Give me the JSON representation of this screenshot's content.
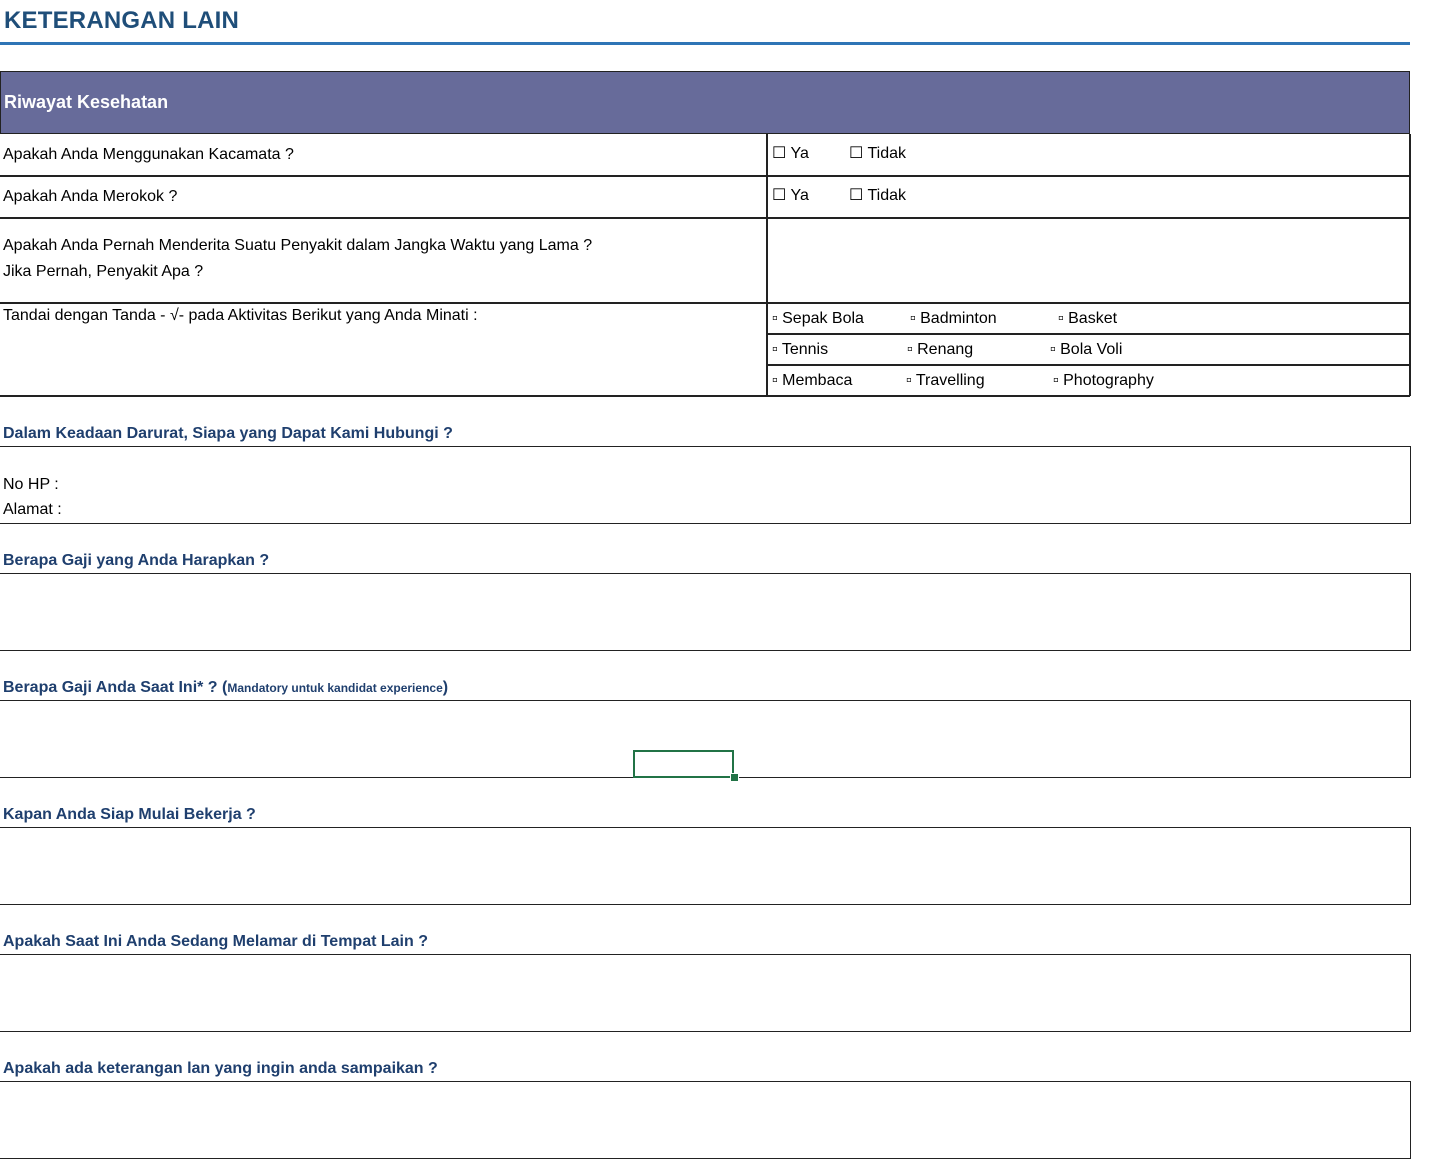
{
  "page_title": "KETERANGAN LAIN",
  "health": {
    "header": "Riwayat Kesehatan",
    "q_glasses": "Apakah Anda Menggunakan Kacamata ?",
    "q_smoke": "Apakah Anda Merokok ?",
    "q_disease_1": "Apakah Anda Pernah Menderita Suatu Penyakit dalam Jangka Waktu yang Lama ?",
    "q_disease_2": "Jika Pernah, Penyakit Apa ?",
    "q_activities": "Tandai dengan Tanda - √- pada Aktivitas Berikut yang Anda Minati :",
    "opt_yes": "☐ Ya",
    "opt_no": "☐ Tidak",
    "activities": {
      "sepak_bola": "▫ Sepak Bola",
      "badminton": "▫ Badminton",
      "basket": "▫ Basket",
      "tennis": "▫ Tennis",
      "renang": "▫ Renang",
      "bola_voli": "▫ Bola Voli",
      "membaca": "▫ Membaca",
      "travelling": "▫ Travelling",
      "photography": "▫ Photography"
    }
  },
  "emergency": {
    "label": "Dalam Keadaan Darurat, Siapa yang Dapat Kami Hubungi ?",
    "phone_label": "No HP :",
    "address_label": "Alamat   :"
  },
  "expected_salary": {
    "label": "Berapa Gaji yang Anda Harapkan ?"
  },
  "current_salary": {
    "label": "Berapa Gaji Anda Saat Ini* ? (",
    "note": "Mandatory untuk kandidat experience",
    "close": ")"
  },
  "start_work": {
    "label": "Kapan Anda Siap Mulai Bekerja ?"
  },
  "other_applications": {
    "label": "Apakah Saat Ini Anda Sedang Melamar di Tempat Lain ?"
  },
  "other_notes": {
    "label": "Apakah ada keterangan lan yang ingin anda sampaikan ?"
  },
  "colors": {
    "title": "#1f4e79",
    "header_bg": "#676b9a",
    "section_label": "#1f3f6e",
    "selection": "#217346"
  }
}
